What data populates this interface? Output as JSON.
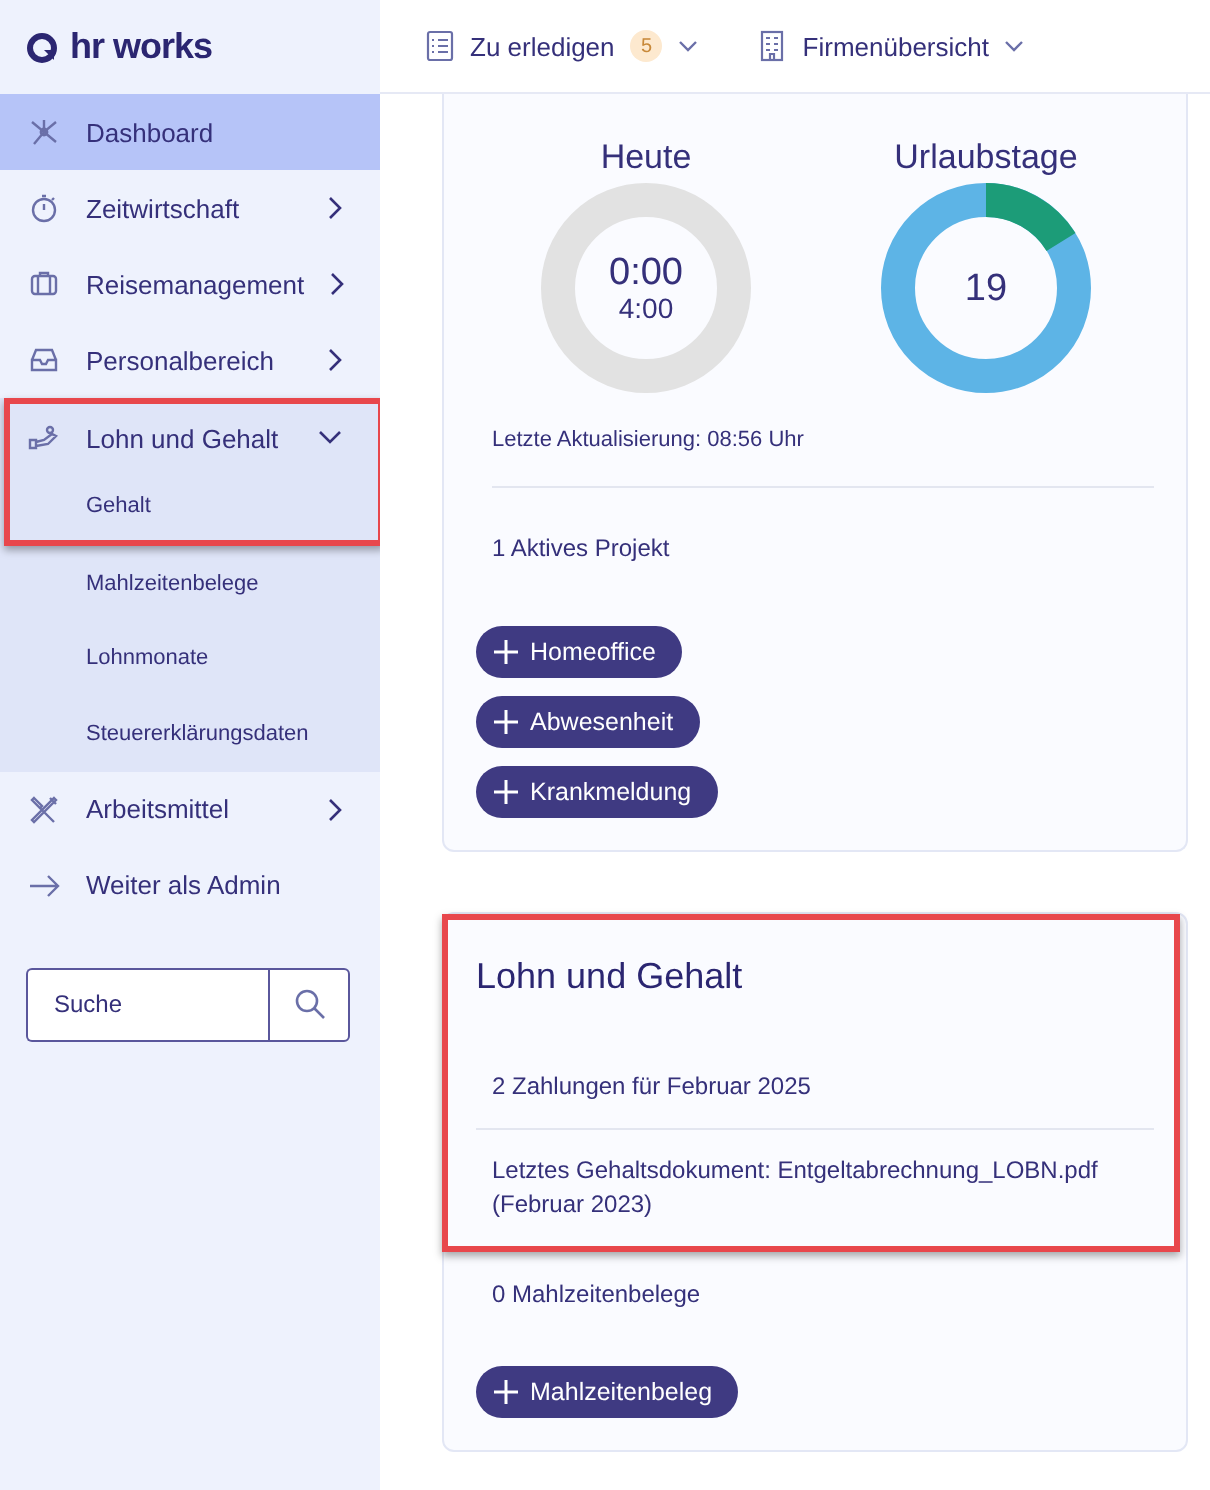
{
  "brand": {
    "name": "hr works"
  },
  "nav": [
    {
      "label": "Dashboard",
      "kind": "link",
      "selected": true
    },
    {
      "label": "Zeitwirtschaft",
      "kind": "group",
      "selected": false,
      "expanded": false
    },
    {
      "label": "Reisemanagement",
      "kind": "group",
      "selected": false,
      "expanded": false
    },
    {
      "label": "Personalbereich",
      "kind": "group",
      "selected": false,
      "expanded": false
    },
    {
      "label": "Lohn und Gehalt",
      "kind": "group",
      "selected": false,
      "expanded": true,
      "highlighted": true,
      "children": [
        {
          "label": "Gehalt",
          "selected": false
        },
        {
          "label": "Mahlzeitenbelege",
          "selected": false
        },
        {
          "label": "Lohnmonate",
          "selected": false
        },
        {
          "label": "Steuererklärungsdaten",
          "selected": false
        }
      ]
    },
    {
      "label": "Arbeitsmittel",
      "kind": "group",
      "selected": false,
      "expanded": false
    },
    {
      "label": "Weiter als Admin",
      "kind": "link",
      "selected": false
    }
  ],
  "search": {
    "placeholder": "Suche"
  },
  "topbar": [
    {
      "label": "Zu erledigen",
      "badge": "5"
    },
    {
      "label": "Firmenübersicht"
    }
  ],
  "time_card": {
    "today": {
      "label": "Heute",
      "worked": "0:00",
      "target": "4:00"
    },
    "vacation": {
      "label": "Urlaubstage",
      "remaining": "19"
    },
    "updated": "Letzte Aktualisierung: 08:56 Uhr",
    "projects": "1 Aktives Projekt",
    "actions": [
      "Homeoffice",
      "Abwesenheit",
      "Krankmeldung"
    ]
  },
  "payroll_card": {
    "title": "Lohn und Gehalt",
    "highlighted": true,
    "rows": [
      "2 Zahlungen für Februar 2025",
      "Letztes Gehaltsdokument: Entgeltabrechnung_LOBN.pdf (Februar 2023)"
    ],
    "meals": "0 Mahlzeitenbelege",
    "actions": [
      "Mahlzeitenbeleg"
    ]
  }
}
